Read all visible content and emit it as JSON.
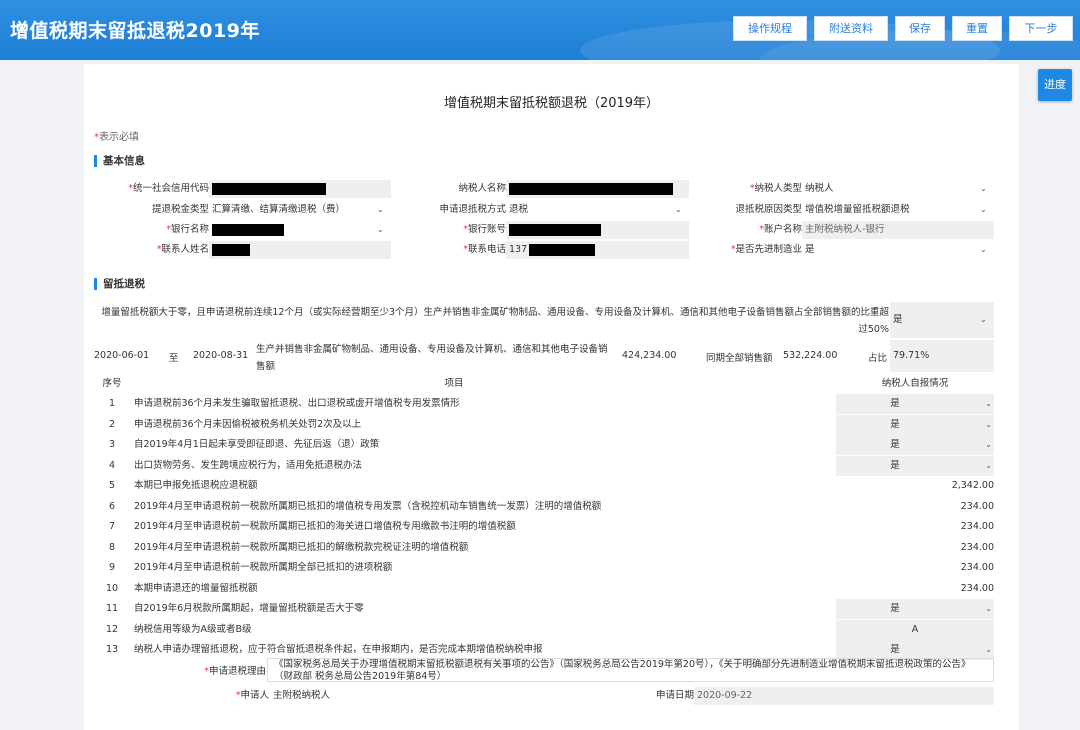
{
  "header": {
    "app_title": "增值税期末留抵退税2019年",
    "buttons": [
      "操作规程",
      "附送资料",
      "保存",
      "重置",
      "下一步"
    ]
  },
  "side": {
    "progress_label": "进度"
  },
  "form": {
    "title": "增值税期末留抵税额退税（2019年）",
    "required_prefix": "*",
    "required_note": "表示必填",
    "basic_section": "基本信息",
    "basic_fields": {
      "credit_code_label": "统一社会信用代码",
      "taxpayer_name_label": "纳税人名称",
      "taxpayer_type_label": "纳税人类型",
      "taxpayer_type_value": "纳税人",
      "refund_type_label": "提退税金类型",
      "refund_type_value": "汇算清缴、结算清缴退税（费）",
      "refund_method_label": "申请退抵税方式",
      "refund_method_value": "退税",
      "refund_reason_label": "退抵税原因类型",
      "refund_reason_value": "增值税增量留抵税额退税",
      "bank_name_label": "银行名称",
      "bank_account_label": "银行账号",
      "account_name_label": "账户名称",
      "account_name_value": "主附税纳税人-银行",
      "contact_name_label": "联系人姓名",
      "contact_phone_label": "联系电话",
      "contact_phone_value": "137",
      "advanced_mfg_label": "是否先进制造业",
      "advanced_mfg_value": "是"
    },
    "refund_section": "留抵退税",
    "condition": {
      "text": "增量留抵税额大于零，且申请退税前连续12个月（或实际经营期至少3个月）生产并销售非金属矿物制品、通用设备、专用设备及计算机、通信和其他电子设备销售额占全部销售额的比重超过50%",
      "value": "是"
    },
    "period": {
      "start": "2020-06-01",
      "to": "至",
      "end": "2020-08-31",
      "desc": "生产并销售非金属矿物制品、通用设备、专用设备及计算机、通信和其他电子设备销售额",
      "amount": "424,234.00",
      "total_label": "同期全部销售额",
      "total": "532,224.00",
      "ratio_label": "占比",
      "ratio": "79.71%"
    },
    "table_headers": {
      "no": "序号",
      "item": "项目",
      "status": "纳税人自报情况"
    },
    "rows": [
      {
        "no": "1",
        "item": "申请退税前36个月未发生骗取留抵退税、出口退税或虚开增值税专用发票情形",
        "value": "是",
        "kind": "select"
      },
      {
        "no": "2",
        "item": "申请退税前36个月未因偷税被税务机关处罚2次及以上",
        "value": "是",
        "kind": "select"
      },
      {
        "no": "3",
        "item": "自2019年4月1日起未享受即征即退、先征后返（退）政策",
        "value": "是",
        "kind": "select"
      },
      {
        "no": "4",
        "item": "出口货物劳务、发生跨境应税行为，适用免抵退税办法",
        "value": "是",
        "kind": "select"
      },
      {
        "no": "5",
        "item": "本期已申报免抵退税应退税额",
        "value": "2,342.00",
        "kind": "num"
      },
      {
        "no": "6",
        "item": "2019年4月至申请退税前一税款所属期已抵扣的增值税专用发票（含税控机动车销售统一发票）注明的增值税额",
        "value": "234.00",
        "kind": "num"
      },
      {
        "no": "7",
        "item": "2019年4月至申请退税前一税款所属期已抵扣的海关进口增值税专用缴款书注明的增值税额",
        "value": "234.00",
        "kind": "num"
      },
      {
        "no": "8",
        "item": "2019年4月至申请退税前一税款所属期已抵扣的解缴税款完税证注明的增值税额",
        "value": "234.00",
        "kind": "num"
      },
      {
        "no": "9",
        "item": "2019年4月至申请退税前一税款所属期全部已抵扣的进项税额",
        "value": "234.00",
        "kind": "num"
      },
      {
        "no": "10",
        "item": "本期申请退还的增量留抵税额",
        "value": "234.00",
        "kind": "num"
      },
      {
        "no": "11",
        "item": "自2019年6月税款所属期起，增量留抵税额是否大于零",
        "value": "是",
        "kind": "select"
      },
      {
        "no": "12",
        "item": "纳税信用等级为A级或者B级",
        "value": "A",
        "kind": "text"
      },
      {
        "no": "13",
        "item": "纳税人申请办理留抵退税，应于符合留抵退税条件起，在申报期内，是否完成本期增值税纳税申报",
        "value": "是",
        "kind": "select"
      }
    ],
    "reason_label": "申请退税理由",
    "reason_text": "《国家税务总局关于办理增值税期末留抵税额退税有关事项的公告》（国家税务总局公告2019年第20号），《关于明确部分先进制造业增值税期末留抵退税政策的公告》（财政部 税务总局公告2019年第84号）",
    "applicant_label": "申请人",
    "applicant_value": "主附税纳税人",
    "apply_date_label": "申请日期",
    "apply_date_value": "2020-09-22"
  }
}
